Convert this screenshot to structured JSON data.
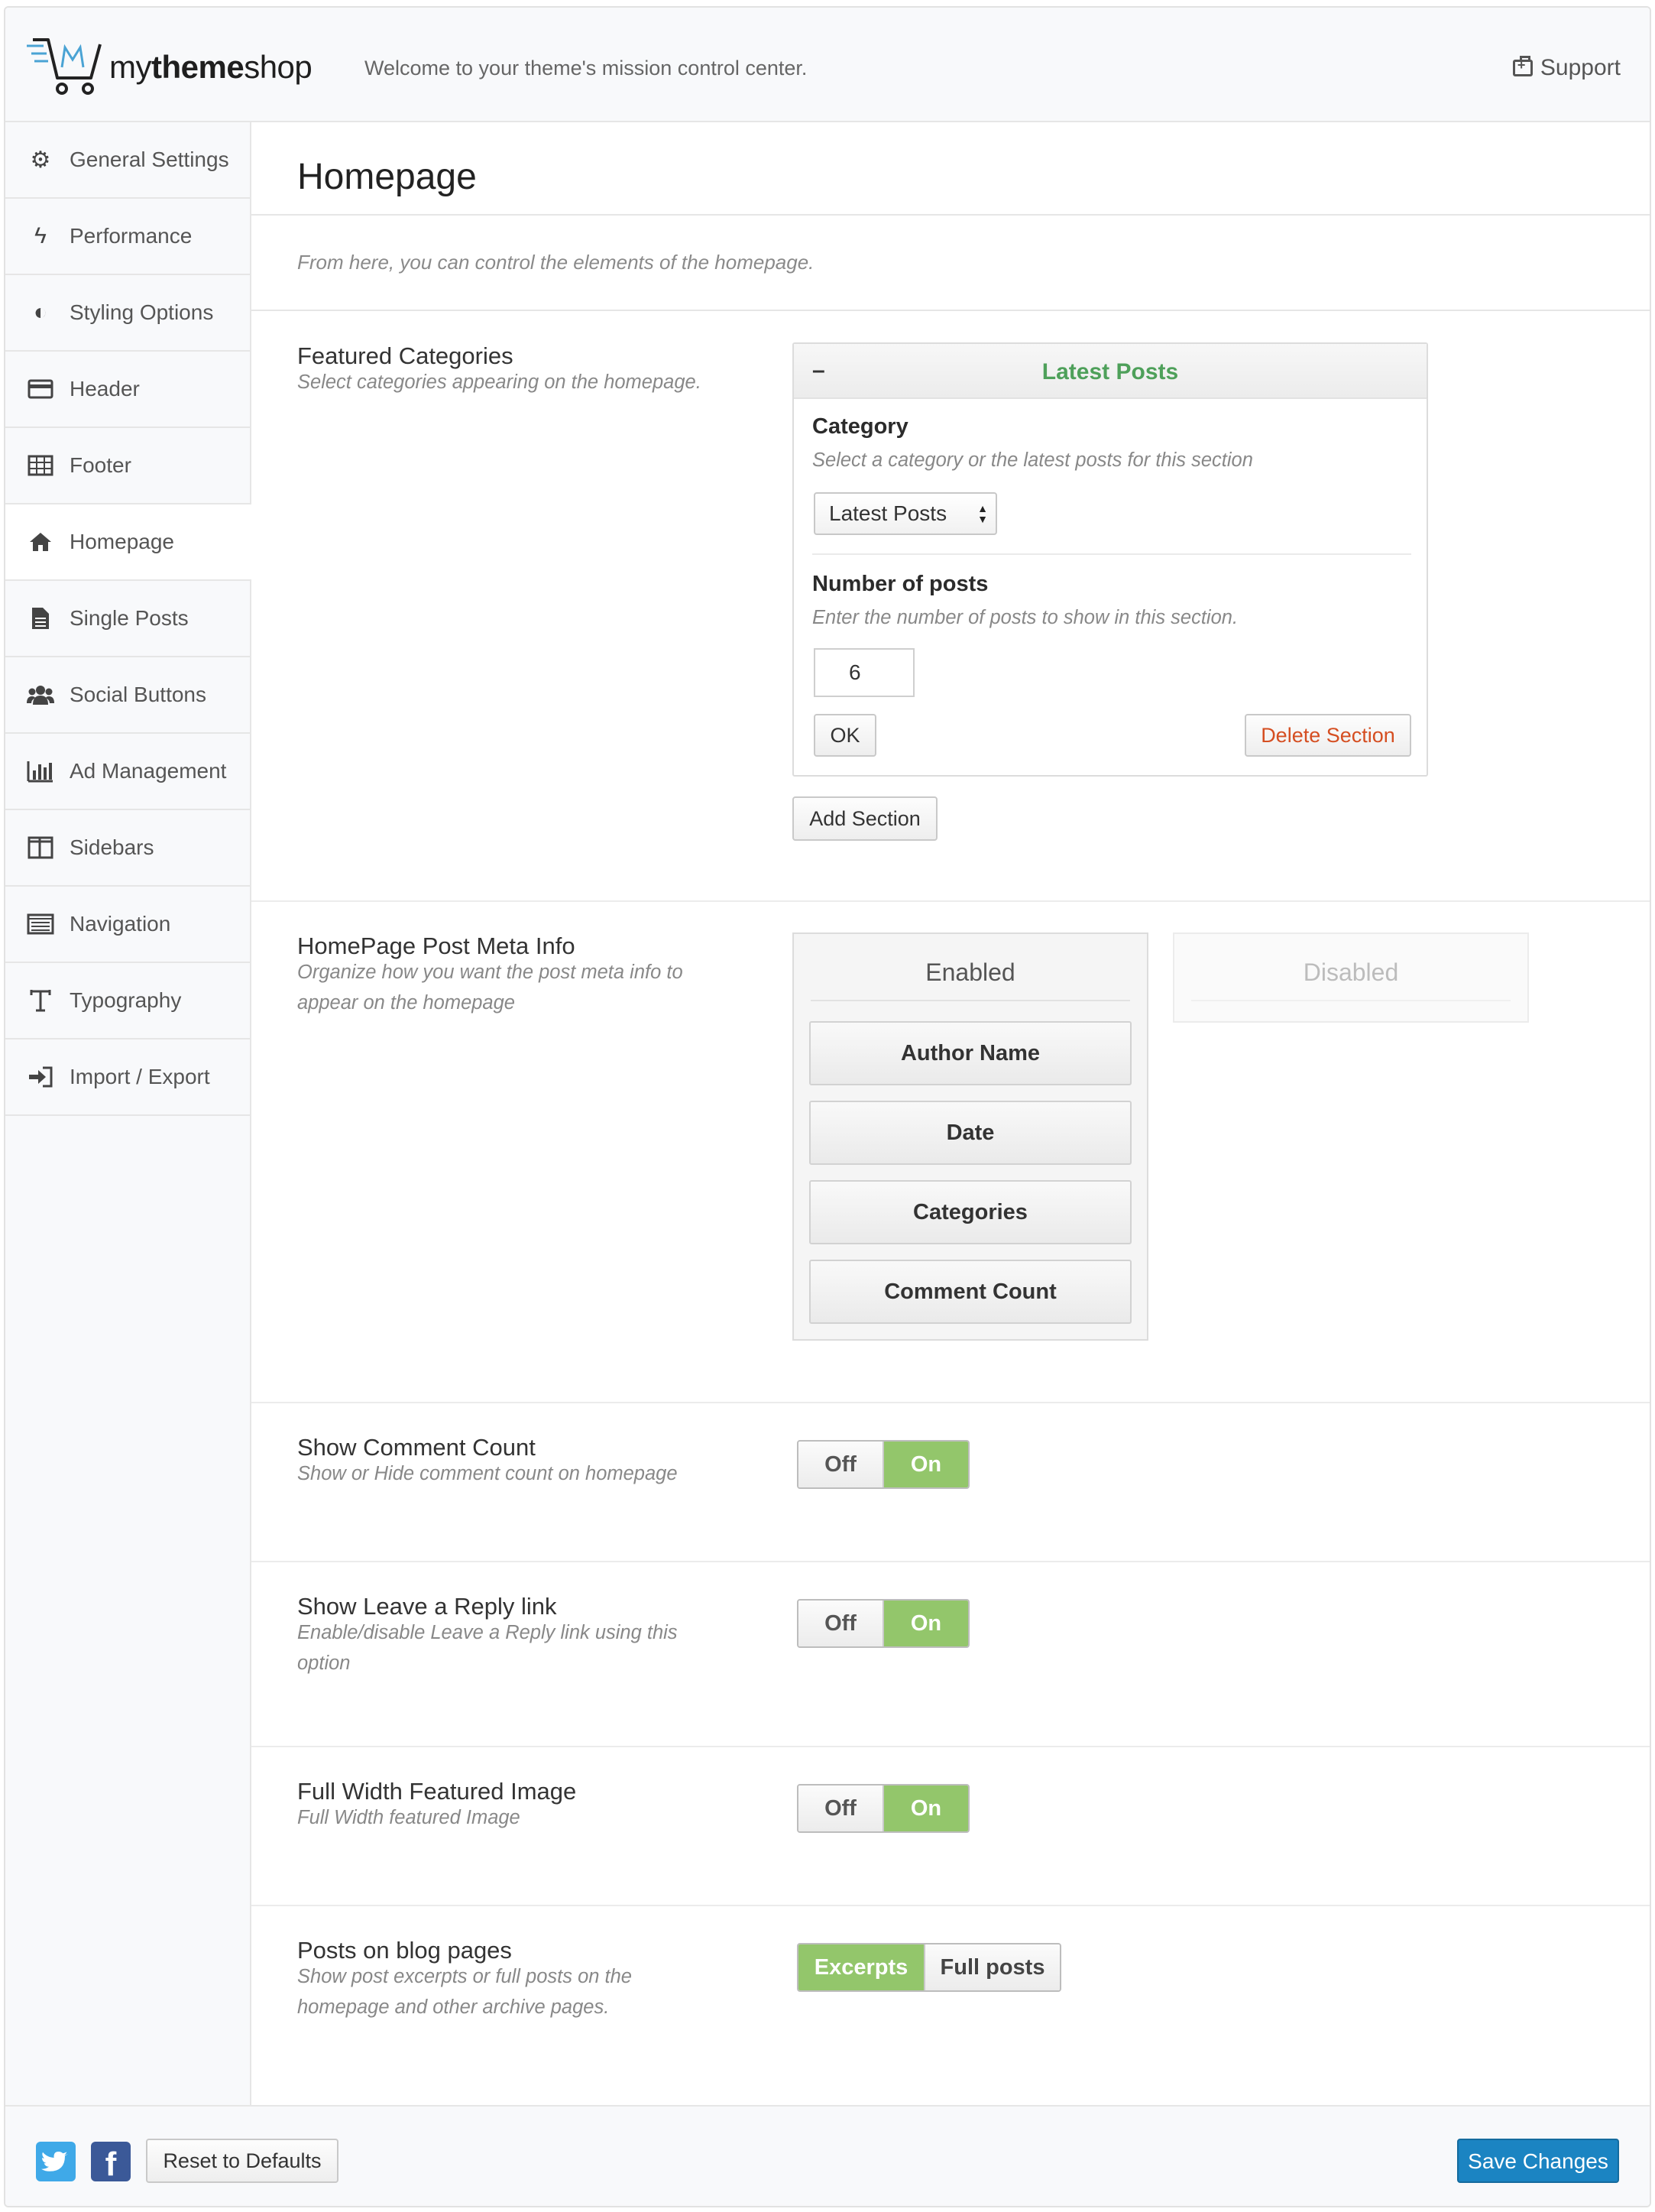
{
  "header": {
    "brand_prefix": "my",
    "brand_bold": "theme",
    "brand_suffix": "shop",
    "welcome": "Welcome to your theme's mission control center.",
    "support_label": "Support"
  },
  "sidebar": {
    "items": [
      {
        "label": "General Settings",
        "icon": "gears-icon"
      },
      {
        "label": "Performance",
        "icon": "bolt-icon"
      },
      {
        "label": "Styling Options",
        "icon": "contrast-icon"
      },
      {
        "label": "Header",
        "icon": "header-card-icon"
      },
      {
        "label": "Footer",
        "icon": "table-icon"
      },
      {
        "label": "Homepage",
        "icon": "home-icon"
      },
      {
        "label": "Single Posts",
        "icon": "document-icon"
      },
      {
        "label": "Social Buttons",
        "icon": "users-icon"
      },
      {
        "label": "Ad Management",
        "icon": "bar-chart-icon"
      },
      {
        "label": "Sidebars",
        "icon": "columns-icon"
      },
      {
        "label": "Navigation",
        "icon": "list-icon"
      },
      {
        "label": "Typography",
        "icon": "text-icon"
      },
      {
        "label": "Import / Export",
        "icon": "sign-in-icon"
      }
    ],
    "active": "Homepage"
  },
  "main": {
    "title": "Homepage",
    "intro": "From here, you can control the elements of the homepage.",
    "featured": {
      "label": "Featured Categories",
      "desc": "Select categories appearing on the homepage.",
      "collapse": "–",
      "section_title": "Latest Posts",
      "category_label": "Category",
      "category_desc": "Select a category or the latest posts for this section",
      "category_value": "Latest Posts",
      "posts_label": "Number of posts",
      "posts_desc": "Enter the number of posts to show in this section.",
      "posts_value": "6",
      "ok_label": "OK",
      "delete_label": "Delete Section",
      "add_label": "Add Section"
    },
    "meta": {
      "label": "HomePage Post Meta Info",
      "desc": "Organize how you want the post meta info to appear on the homepage",
      "enabled_title": "Enabled",
      "disabled_title": "Disabled",
      "enabled_items": [
        "Author Name",
        "Date",
        "Categories",
        "Comment Count"
      ]
    },
    "comment_count": {
      "label": "Show Comment Count",
      "desc": "Show or Hide comment count on homepage",
      "off": "Off",
      "on": "On"
    },
    "reply_link": {
      "label": "Show Leave a Reply link",
      "desc": "Enable/disable Leave a Reply link using this option",
      "off": "Off",
      "on": "On"
    },
    "full_width": {
      "label": "Full Width Featured Image",
      "desc": "Full Width featured Image",
      "off": "Off",
      "on": "On"
    },
    "blog_posts": {
      "label": "Posts on blog pages",
      "desc": "Show post excerpts or full posts on the homepage and other archive pages.",
      "excerpts": "Excerpts",
      "full": "Full posts"
    }
  },
  "footer": {
    "fb_glyph": "f",
    "reset_label": "Reset to Defaults",
    "save_label": "Save Changes"
  },
  "colors": {
    "accent_green": "#93c66b",
    "title_green": "#4ea05a",
    "save_blue": "#1b84c2",
    "delete_red": "#d54e21",
    "twitter_blue": "#3fa9e8",
    "facebook_blue": "#3b5998"
  }
}
